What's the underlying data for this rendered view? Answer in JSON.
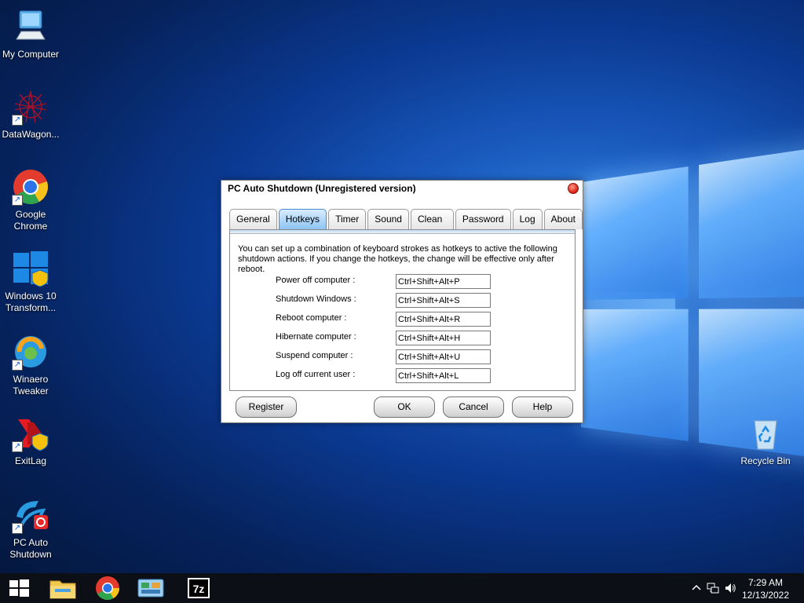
{
  "desktop": {
    "icons": [
      {
        "label": "My Computer",
        "icon": "computer-icon"
      },
      {
        "label": "DataWagon...",
        "icon": "datawagon-icon"
      },
      {
        "label": "Google Chrome",
        "icon": "chrome-icon"
      },
      {
        "label": "Windows 10 Transform...",
        "icon": "windows-transform-icon"
      },
      {
        "label": "Winaero Tweaker",
        "icon": "winaero-icon"
      },
      {
        "label": "ExitLag",
        "icon": "exitlag-icon"
      },
      {
        "label": "PC Auto Shutdown",
        "icon": "pc-auto-shutdown-icon"
      },
      {
        "label": "Recycle Bin",
        "icon": "recycle-bin-icon"
      }
    ]
  },
  "dialog": {
    "title": "PC Auto Shutdown (Unregistered version)",
    "tabs": [
      "General",
      "Hotkeys",
      "Timer",
      "Sound",
      "Clean up",
      "Password",
      "Log",
      "About"
    ],
    "active_tab": "Hotkeys",
    "description": "You can set up a combination of keyboard strokes as hotkeys to active the following shutdown actions. If you change the hotkeys, the change will be effective only after reboot.",
    "hotkeys": [
      {
        "label": "Power off computer :",
        "value": "Ctrl+Shift+Alt+P"
      },
      {
        "label": "Shutdown Windows :",
        "value": "Ctrl+Shift+Alt+S"
      },
      {
        "label": "Reboot computer :",
        "value": "Ctrl+Shift+Alt+R"
      },
      {
        "label": "Hibernate computer :",
        "value": "Ctrl+Shift+Alt+H"
      },
      {
        "label": "Suspend computer :",
        "value": "Ctrl+Shift+Alt+U"
      },
      {
        "label": "Log off current user :",
        "value": "Ctrl+Shift+Alt+L"
      }
    ],
    "buttons": {
      "register": "Register",
      "ok": "OK",
      "cancel": "Cancel",
      "help": "Help"
    }
  },
  "taskbar": {
    "items": [
      "start-icon",
      "file-explorer-icon",
      "chrome-icon",
      "control-panel-icon",
      "7zip-icon"
    ],
    "clock_time": "7:29 AM",
    "clock_date": "12/13/2022"
  },
  "colors": {
    "accent_tab": "#8ec4f2",
    "taskbar": "#0c0f16",
    "close": "#d81d10"
  }
}
